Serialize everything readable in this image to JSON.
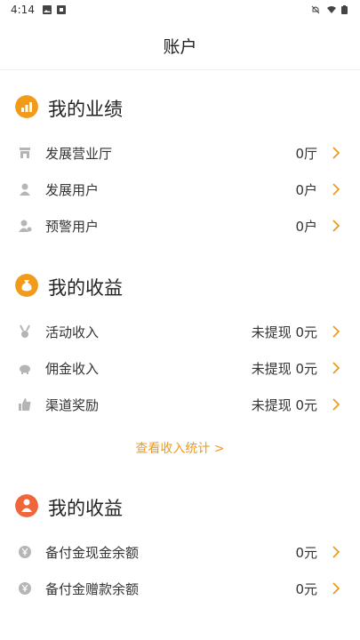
{
  "status": {
    "time": "4:14"
  },
  "header": {
    "title": "账户"
  },
  "performance": {
    "title": "我的业绩",
    "items": [
      {
        "label": "发展营业厅",
        "value": "0厅"
      },
      {
        "label": "发展用户",
        "value": "0户"
      },
      {
        "label": "预警用户",
        "value": "0户"
      }
    ]
  },
  "earnings": {
    "title": "我的收益",
    "items": [
      {
        "label": "活动收入",
        "value": "未提现 0元"
      },
      {
        "label": "佣金收入",
        "value": "未提现 0元"
      },
      {
        "label": "渠道奖励",
        "value": "未提现 0元"
      }
    ],
    "stats_link": "查看收入统计 >"
  },
  "reserve": {
    "title": "我的收益",
    "items": [
      {
        "label": "备付金现金余额",
        "value": "0元"
      },
      {
        "label": "备付金赠款余额",
        "value": "0元"
      }
    ]
  },
  "colors": {
    "accent": "#f09a1a",
    "icon_gray": "#b5b5b5"
  }
}
